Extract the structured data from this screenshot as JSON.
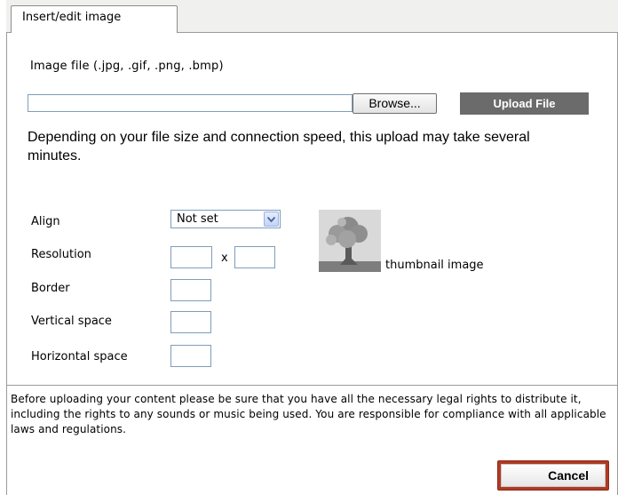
{
  "tab": {
    "label": "Insert/edit image"
  },
  "upload": {
    "file_label": "Image file (.jpg, .gif, .png, .bmp)",
    "file_value": "",
    "browse_label": "Browse...",
    "upload_label": "Upload File",
    "note": "Depending on your file size and connection speed, this upload may take several minutes."
  },
  "form": {
    "align_label": "Align",
    "align_value": "Not set",
    "resolution_label": "Resolution",
    "resolution_sep": "x",
    "border_label": "Border",
    "vspace_label": "Vertical space",
    "hspace_label": "Horizontal space"
  },
  "thumbnail": {
    "caption": "thumbnail image",
    "icon": "tree-placeholder-icon"
  },
  "legal": {
    "text": "Before uploading your content please be sure that you have all the necessary legal rights to distribute it, including the rights to any sounds or music being used. You are responsible for compliance with all applicable laws and regulations."
  },
  "footer": {
    "cancel_label": "Cancel"
  },
  "colors": {
    "upload_button": "#6b6b6b",
    "cancel_border": "#b03a24",
    "input_border": "#7f9db9"
  }
}
